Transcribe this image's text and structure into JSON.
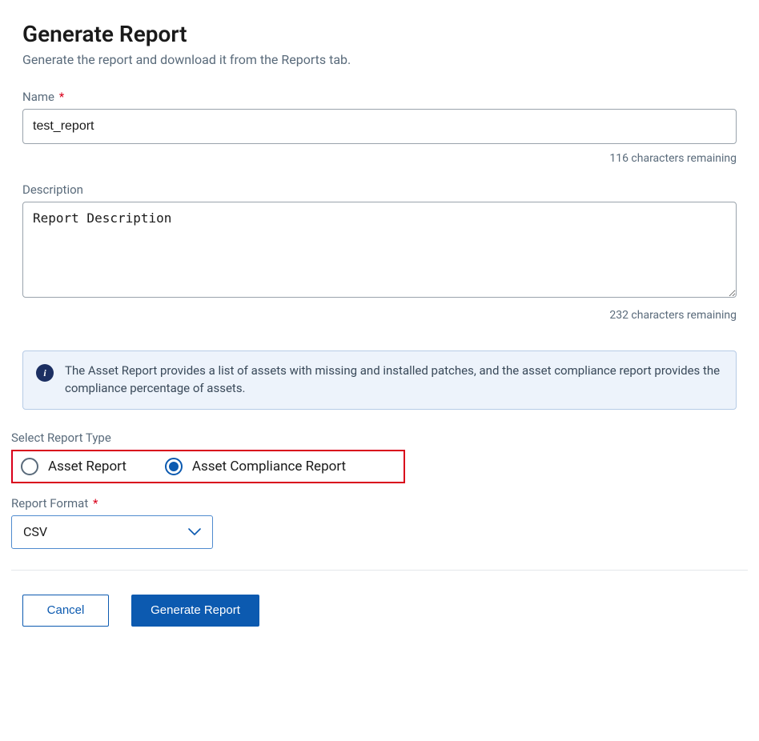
{
  "header": {
    "title": "Generate Report",
    "subtitle": "Generate the report and download it from the Reports tab."
  },
  "nameField": {
    "label": "Name",
    "value": "test_report",
    "charRemaining": "116 characters remaining"
  },
  "descriptionField": {
    "label": "Description",
    "value": "Report Description",
    "charRemaining": "232 characters remaining"
  },
  "infoBanner": {
    "text": "The Asset Report provides a list of assets with missing and installed patches, and the asset compliance report provides the compliance percentage of assets."
  },
  "reportType": {
    "label": "Select Report Type",
    "options": [
      {
        "label": "Asset Report",
        "selected": false
      },
      {
        "label": "Asset Compliance Report",
        "selected": true
      }
    ]
  },
  "reportFormat": {
    "label": "Report Format",
    "value": "CSV"
  },
  "actions": {
    "cancel": "Cancel",
    "generate": "Generate Report"
  },
  "required": "*"
}
